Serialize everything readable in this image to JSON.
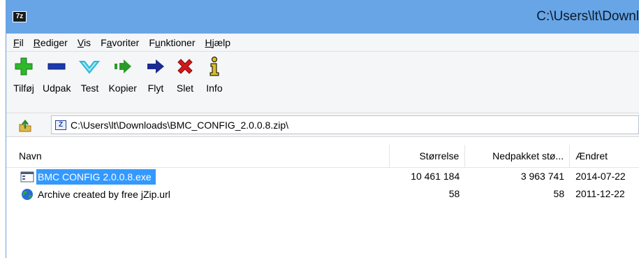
{
  "window": {
    "title": "C:\\Users\\lt\\Downl",
    "app_icon_text": "7z"
  },
  "menu": {
    "items": [
      {
        "mnemonic": "F",
        "rest": "il"
      },
      {
        "mnemonic": "R",
        "rest": "ediger"
      },
      {
        "mnemonic": "V",
        "rest": "is"
      },
      {
        "pre": "F",
        "mnemonic": "a",
        "rest": "voriter"
      },
      {
        "pre": "F",
        "mnemonic": "u",
        "rest": "nktioner"
      },
      {
        "mnemonic": "H",
        "rest": "jælp"
      }
    ]
  },
  "toolbar": {
    "buttons": [
      {
        "label": "Tilføj",
        "icon": "plus-icon",
        "color": "#2eb82e"
      },
      {
        "label": "Udpak",
        "icon": "minus-icon",
        "color": "#1a3ab0"
      },
      {
        "label": "Test",
        "icon": "check-icon",
        "color": "#28b8d8"
      },
      {
        "label": "Kopier",
        "icon": "double-arrow-icon",
        "color": "#2a9a2a"
      },
      {
        "label": "Flyt",
        "icon": "arrow-right-icon",
        "color": "#1a2a90"
      },
      {
        "label": "Slet",
        "icon": "x-icon",
        "color": "#d01818"
      },
      {
        "label": "Info",
        "icon": "info-icon",
        "color": "#d8c020"
      }
    ]
  },
  "address": {
    "path": "C:\\Users\\lt\\Downloads\\BMC_CONFIG_2.0.0.8.zip\\",
    "icon_text": "Z"
  },
  "list": {
    "columns": {
      "name": "Navn",
      "size": "Størrelse",
      "packed": "Nedpakket stø...",
      "modified": "Ændret"
    },
    "rows": [
      {
        "name": "BMC CONFIG 2.0.0.8.exe",
        "size": "10 461 184",
        "packed": "3 963 741",
        "modified": "2014-07-22",
        "selected": true,
        "icon": "exe-window-icon"
      },
      {
        "name": "Archive created by free jZip.url",
        "size": "58",
        "packed": "58",
        "modified": "2011-12-22",
        "selected": false,
        "icon": "globe-icon"
      }
    ]
  },
  "colors": {
    "titlebar": "#68a5e6",
    "selection": "#3399ff"
  }
}
